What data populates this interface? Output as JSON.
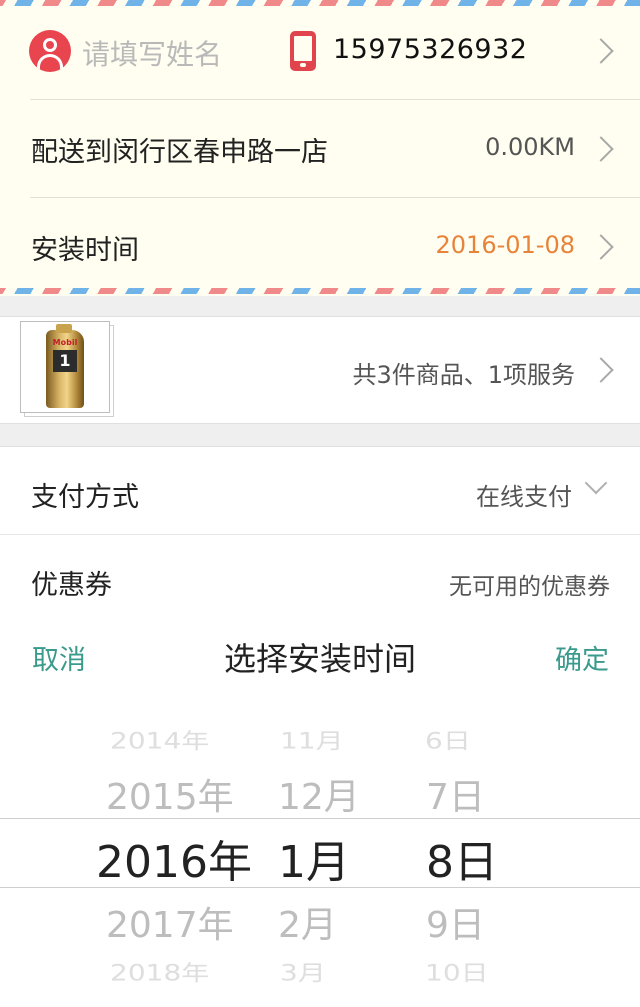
{
  "address": {
    "name_placeholder": "请填写姓名",
    "phone": "15975326932",
    "delivery_label": "配送到闵行区春申路一店",
    "distance": "0.00KM",
    "install_time_label": "安装时间",
    "install_time_value": "2016-01-08"
  },
  "goods": {
    "product_brand": "Mobil",
    "product_number": "1",
    "summary": "共3件商品、1项服务"
  },
  "payment": {
    "label": "支付方式",
    "value": "在线支付"
  },
  "coupon": {
    "label": "优惠券",
    "value": "无可用的优惠券"
  },
  "picker": {
    "cancel": "取消",
    "title": "选择安装时间",
    "confirm": "确定",
    "years": [
      "2014年",
      "2015年",
      "2016年",
      "2017年",
      "2018年"
    ],
    "months": [
      "11月",
      "12月",
      "1月",
      "2月",
      "3月"
    ],
    "days": [
      "6日",
      "7日",
      "8日",
      "9日",
      "10日"
    ]
  },
  "colors": {
    "accent_teal": "#3a9a8c",
    "date_orange": "#e8833a",
    "icon_red": "#e0454e"
  }
}
